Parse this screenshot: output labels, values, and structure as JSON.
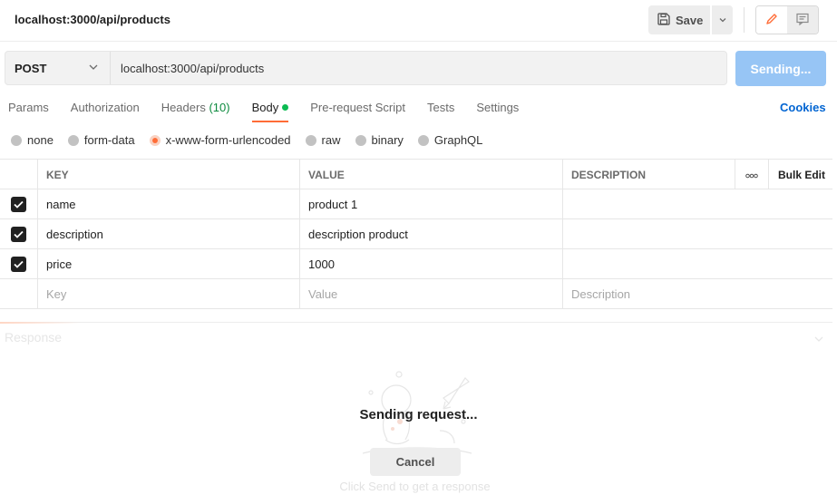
{
  "header": {
    "title": "localhost:3000/api/products",
    "save_label": "Save"
  },
  "request": {
    "method": "POST",
    "url": "localhost:3000/api/products",
    "send_label": "Sending..."
  },
  "tabs": {
    "params": "Params",
    "authorization": "Authorization",
    "headers": "Headers",
    "headers_count": "(10)",
    "body": "Body",
    "pre_request": "Pre-request Script",
    "tests": "Tests",
    "settings": "Settings",
    "cookies": "Cookies",
    "active": "Body"
  },
  "body_types": {
    "none": "none",
    "form_data": "form-data",
    "urlencoded": "x-www-form-urlencoded",
    "raw": "raw",
    "binary": "binary",
    "graphql": "GraphQL",
    "selected": "x-www-form-urlencoded"
  },
  "table": {
    "headers": {
      "key": "KEY",
      "value": "VALUE",
      "description": "DESCRIPTION",
      "more": "ooo",
      "bulk_edit": "Bulk Edit"
    },
    "rows": [
      {
        "key": "name",
        "value": "product 1",
        "checked": true
      },
      {
        "key": "description",
        "value": "description product",
        "checked": true
      },
      {
        "key": "price",
        "value": "1000",
        "checked": true
      }
    ],
    "placeholders": {
      "key": "Key",
      "value": "Value",
      "description": "Description"
    }
  },
  "response": {
    "label": "Response",
    "status_text": "Sending request...",
    "cancel_label": "Cancel",
    "hint": "Click Send to get a response"
  },
  "icons": {
    "save": "save-icon",
    "caret": "chevron-down-icon",
    "edit": "pencil-icon",
    "comments": "comment-icon",
    "check": "checkmark-icon"
  },
  "colors": {
    "accent": "#ff6c37",
    "send_button": "#97c5f5",
    "link": "#0265d2",
    "status_green": "#0cbb52"
  }
}
